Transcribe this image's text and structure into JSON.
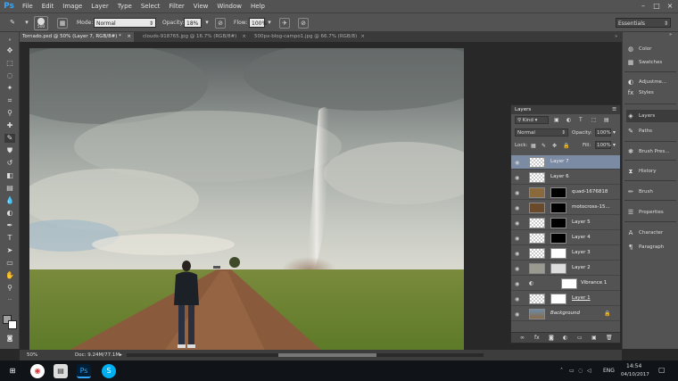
{
  "menubar": {
    "logo": "Ps",
    "items": [
      "File",
      "Edit",
      "Image",
      "Layer",
      "Type",
      "Select",
      "Filter",
      "View",
      "Window",
      "Help"
    ]
  },
  "options": {
    "brush_size": "500",
    "mode_label": "Mode:",
    "mode_value": "Normal",
    "opacity_label": "Opacity:",
    "opacity_value": "18%",
    "flow_label": "Flow:",
    "flow_value": "100%",
    "workspace": "Essentials"
  },
  "tabs": [
    "Tornado.psd @ 50% (Layer 7, RGB/8#) *",
    "clouds-918765.jpg @ 16.7% (RGB/8#)",
    "500px-blog-campo1.jpg @ 66.7% (RGB/8)"
  ],
  "right_panel": {
    "items": [
      "Color",
      "Swatches",
      "Adjustme...",
      "Styles",
      "Layers",
      "Paths",
      "Brush Pres...",
      "History",
      "Brush",
      "Properties",
      "Character",
      "Paragraph"
    ]
  },
  "layers_panel": {
    "title": "Layers",
    "filter_label": "Kind",
    "blend_mode": "Normal",
    "opacity_label": "Opacity:",
    "opacity_value": "100%",
    "lock_label": "Lock:",
    "fill_label": "Fill:",
    "fill_value": "100%",
    "layers": [
      {
        "name": "Layer 7",
        "selected": true
      },
      {
        "name": "Layer 6"
      },
      {
        "name": "quad-1676818"
      },
      {
        "name": "motocross-15..."
      },
      {
        "name": "Layer 5"
      },
      {
        "name": "Layer 4"
      },
      {
        "name": "Layer 3"
      },
      {
        "name": "Layer 2"
      },
      {
        "name": "Vibrance 1"
      },
      {
        "name": "Layer 1"
      },
      {
        "name": "Background"
      }
    ]
  },
  "status": {
    "zoom": "50%",
    "doc": "Doc: 9.24M/77.1M"
  },
  "taskbar": {
    "language": "ENG",
    "time": "14:54",
    "date": "04/10/2017"
  },
  "colors": {
    "accent": "#31a8ff",
    "selection": "#7a8ba3"
  }
}
